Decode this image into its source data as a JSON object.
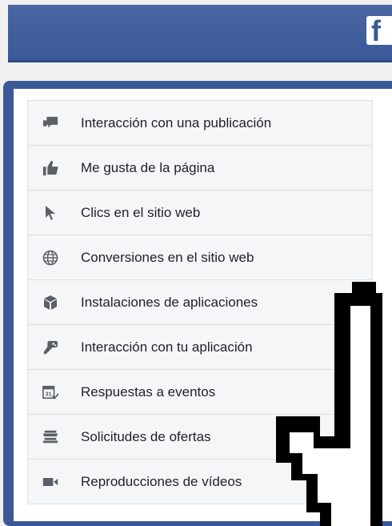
{
  "header": {
    "logo_letter": "f"
  },
  "objectives": [
    {
      "label": "Interacción con una publicación",
      "icon": "post-engagement-icon"
    },
    {
      "label": "Me gusta de la página",
      "icon": "thumbs-up-icon"
    },
    {
      "label": "Clics en el sitio web",
      "icon": "pointer-icon"
    },
    {
      "label": "Conversiones en el sitio web",
      "icon": "globe-icon"
    },
    {
      "label": "Instalaciones de aplicaciones",
      "icon": "box-icon"
    },
    {
      "label": "Interacción con tu aplicación",
      "icon": "gamepad-icon"
    },
    {
      "label": "Respuestas a eventos",
      "icon": "calendar-icon"
    },
    {
      "label": "Solicitudes de ofertas",
      "icon": "store-icon"
    },
    {
      "label": "Reproducciones de vídeos",
      "icon": "video-camera-icon"
    }
  ],
  "colors": {
    "brand": "#3b5998",
    "icon_gray": "#5a6066"
  }
}
